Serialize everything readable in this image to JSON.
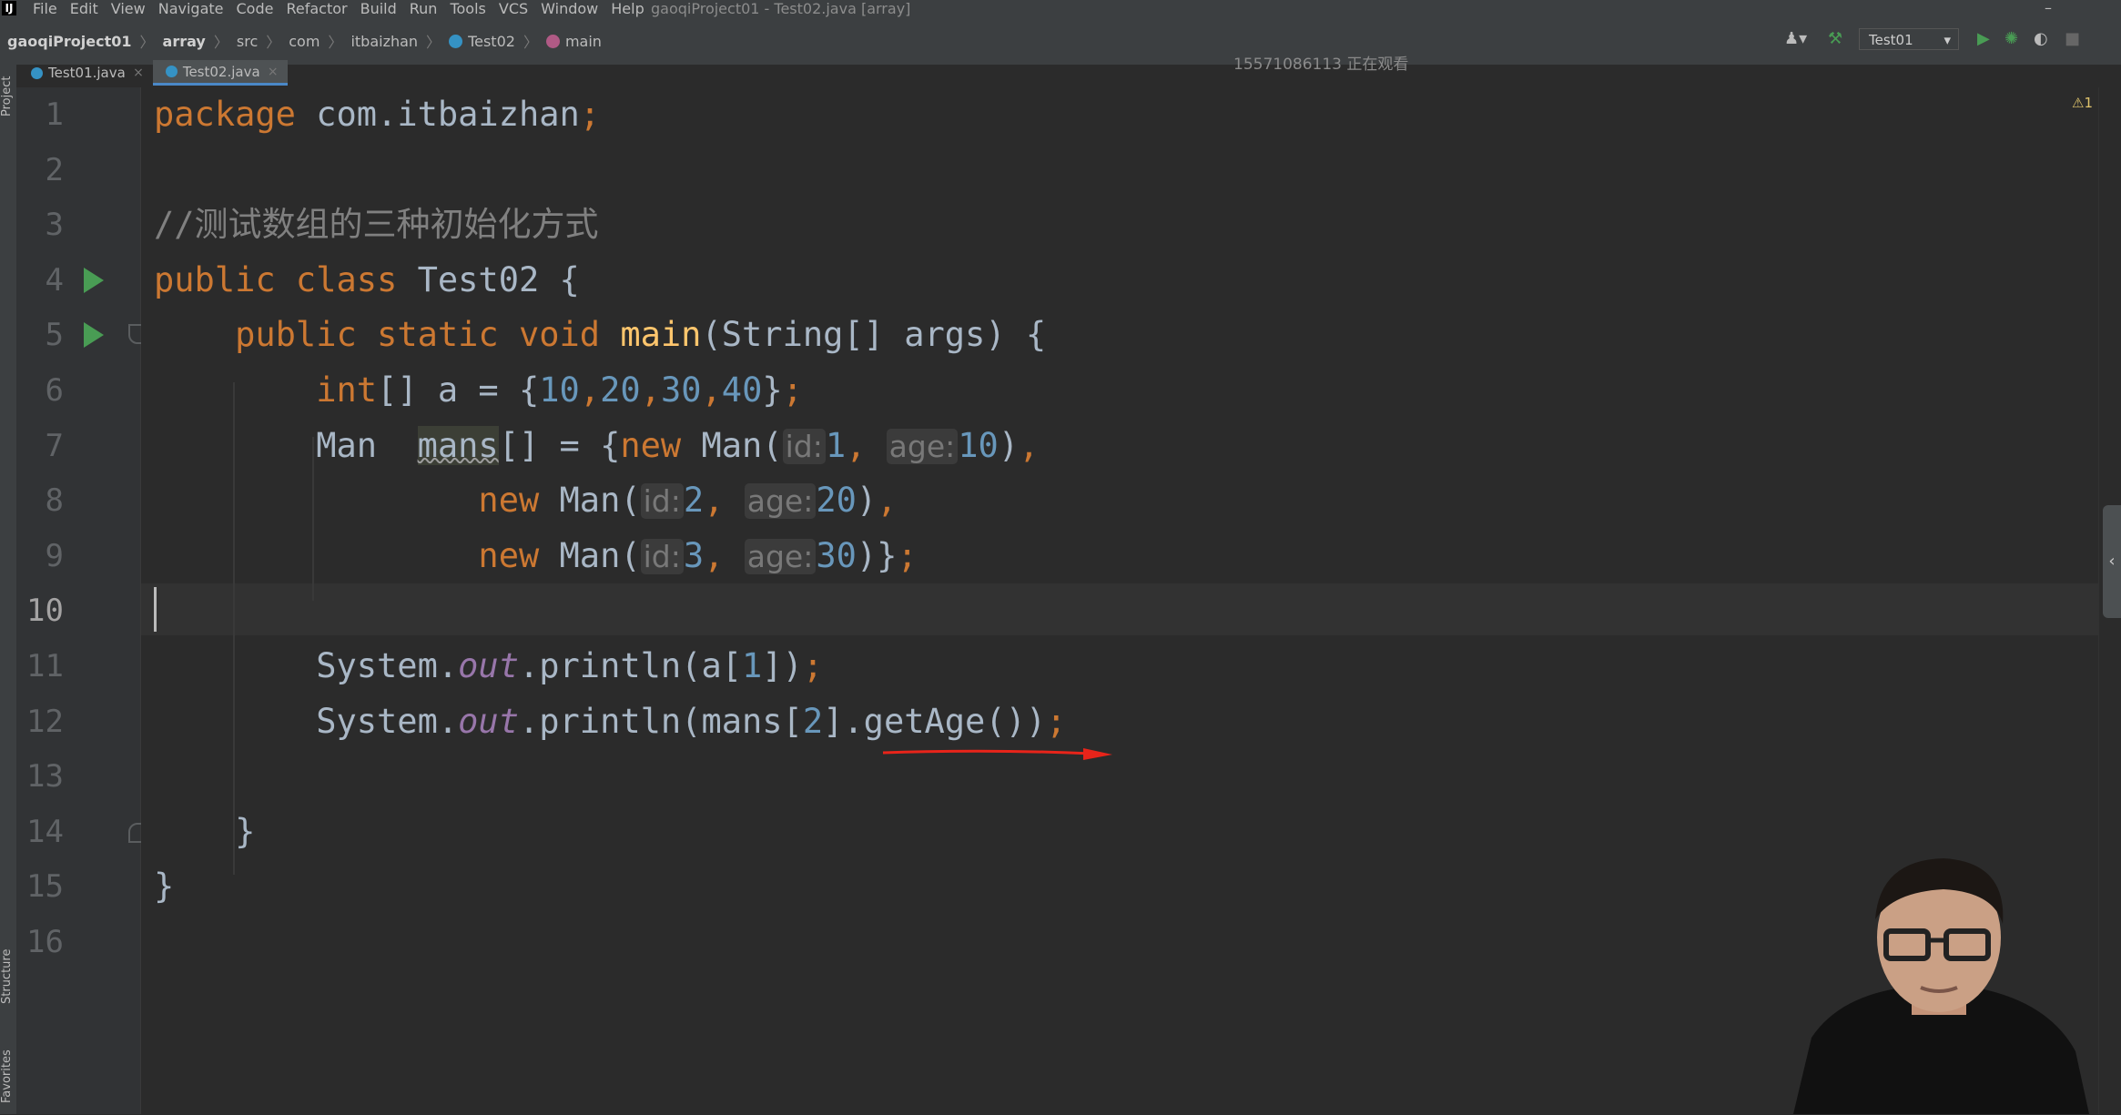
{
  "menubar": {
    "logo_letter": "IJ",
    "items": [
      "File",
      "Edit",
      "View",
      "Navigate",
      "Code",
      "Refactor",
      "Build",
      "Run",
      "Tools",
      "VCS",
      "Window",
      "Help"
    ],
    "window_title": "gaoqiProject01 - Test02.java [array]",
    "minimize": "–"
  },
  "navbar": {
    "breadcrumbs": [
      {
        "label": "gaoqiProject01",
        "icon": ""
      },
      {
        "label": "array",
        "icon": ""
      },
      {
        "label": "src",
        "icon": ""
      },
      {
        "label": "com",
        "icon": ""
      },
      {
        "label": "itbaizhan",
        "icon": ""
      },
      {
        "label": "Test02",
        "icon": "class-icon"
      },
      {
        "label": "main",
        "icon": "method-icon"
      }
    ],
    "watcher_text": "15571086113 正在观看",
    "run_config": "Test01"
  },
  "tabs": [
    {
      "label": "Test01.java",
      "active": false
    },
    {
      "label": "Test02.java",
      "active": true
    }
  ],
  "side_tools": {
    "project": "Project",
    "structure": "Structure",
    "favorites": "Favorites"
  },
  "editor": {
    "warning_count": "1",
    "current_line": 10,
    "line_numbers": [
      "1",
      "2",
      "3",
      "4",
      "5",
      "6",
      "7",
      "8",
      "9",
      "10",
      "11",
      "12",
      "13",
      "14",
      "15",
      "16"
    ],
    "lines": [
      {
        "segs": [
          [
            "kw",
            "package "
          ],
          [
            "t",
            "com.itbaizhan"
          ],
          [
            "kw",
            ";"
          ]
        ]
      },
      {
        "segs": []
      },
      {
        "segs": [
          [
            "cmt",
            "//测试数组的三种初始化方式"
          ]
        ]
      },
      {
        "segs": [
          [
            "kw",
            "public class "
          ],
          [
            "t",
            "Test02 {"
          ]
        ]
      },
      {
        "segs": [
          [
            "t",
            "    "
          ],
          [
            "kw",
            "public static void "
          ],
          [
            "fn",
            "main"
          ],
          [
            "t",
            "(String[] args) {"
          ]
        ]
      },
      {
        "segs": [
          [
            "t",
            "        "
          ],
          [
            "kw",
            "int"
          ],
          [
            "t",
            "[] a = {"
          ],
          [
            "num",
            "10"
          ],
          [
            "kw",
            ","
          ],
          [
            "num",
            "20"
          ],
          [
            "kw",
            ","
          ],
          [
            "num",
            "30"
          ],
          [
            "kw",
            ","
          ],
          [
            "num",
            "40"
          ],
          [
            "t",
            "}"
          ],
          [
            "kw",
            ";"
          ]
        ]
      },
      {
        "segs": [
          [
            "t",
            "        Man  "
          ],
          [
            "hl",
            "mans"
          ],
          [
            "t",
            "[] = {"
          ],
          [
            "kw",
            "new "
          ],
          [
            "t",
            "Man("
          ],
          [
            "hint",
            "id:"
          ],
          [
            "num",
            "1"
          ],
          [
            "kw",
            ", "
          ],
          [
            "hint",
            "age:"
          ],
          [
            "num",
            "10"
          ],
          [
            "t",
            ")"
          ],
          [
            "kw",
            ","
          ]
        ]
      },
      {
        "segs": [
          [
            "t",
            "                "
          ],
          [
            "kw",
            "new "
          ],
          [
            "t",
            "Man("
          ],
          [
            "hint",
            "id:"
          ],
          [
            "num",
            "2"
          ],
          [
            "kw",
            ", "
          ],
          [
            "hint",
            "age:"
          ],
          [
            "num",
            "20"
          ],
          [
            "t",
            ")"
          ],
          [
            "kw",
            ","
          ]
        ]
      },
      {
        "segs": [
          [
            "t",
            "                "
          ],
          [
            "kw",
            "new "
          ],
          [
            "t",
            "Man("
          ],
          [
            "hint",
            "id:"
          ],
          [
            "num",
            "3"
          ],
          [
            "kw",
            ", "
          ],
          [
            "hint",
            "age:"
          ],
          [
            "num",
            "30"
          ],
          [
            "t",
            ")}"
          ],
          [
            "kw",
            ";"
          ]
        ]
      },
      {
        "segs": []
      },
      {
        "segs": [
          [
            "t",
            "        System."
          ],
          [
            "fld",
            "out"
          ],
          [
            "t",
            ".println(a["
          ],
          [
            "num",
            "1"
          ],
          [
            "t",
            "])"
          ],
          [
            "kw",
            ";"
          ]
        ]
      },
      {
        "segs": [
          [
            "t",
            "        System."
          ],
          [
            "fld",
            "out"
          ],
          [
            "t",
            ".println(mans["
          ],
          [
            "num",
            "2"
          ],
          [
            "t",
            "].getAge())"
          ],
          [
            "kw",
            ";"
          ]
        ]
      },
      {
        "segs": []
      },
      {
        "segs": [
          [
            "t",
            "    }"
          ]
        ]
      },
      {
        "segs": [
          [
            "t",
            "}"
          ]
        ]
      },
      {
        "segs": []
      }
    ]
  },
  "colors": {
    "keyword": "#cc7832",
    "number": "#6897bb",
    "comment": "#808080",
    "method": "#ffc66d",
    "static_field": "#9876aa",
    "annotation_arrow": "#e8241a"
  }
}
